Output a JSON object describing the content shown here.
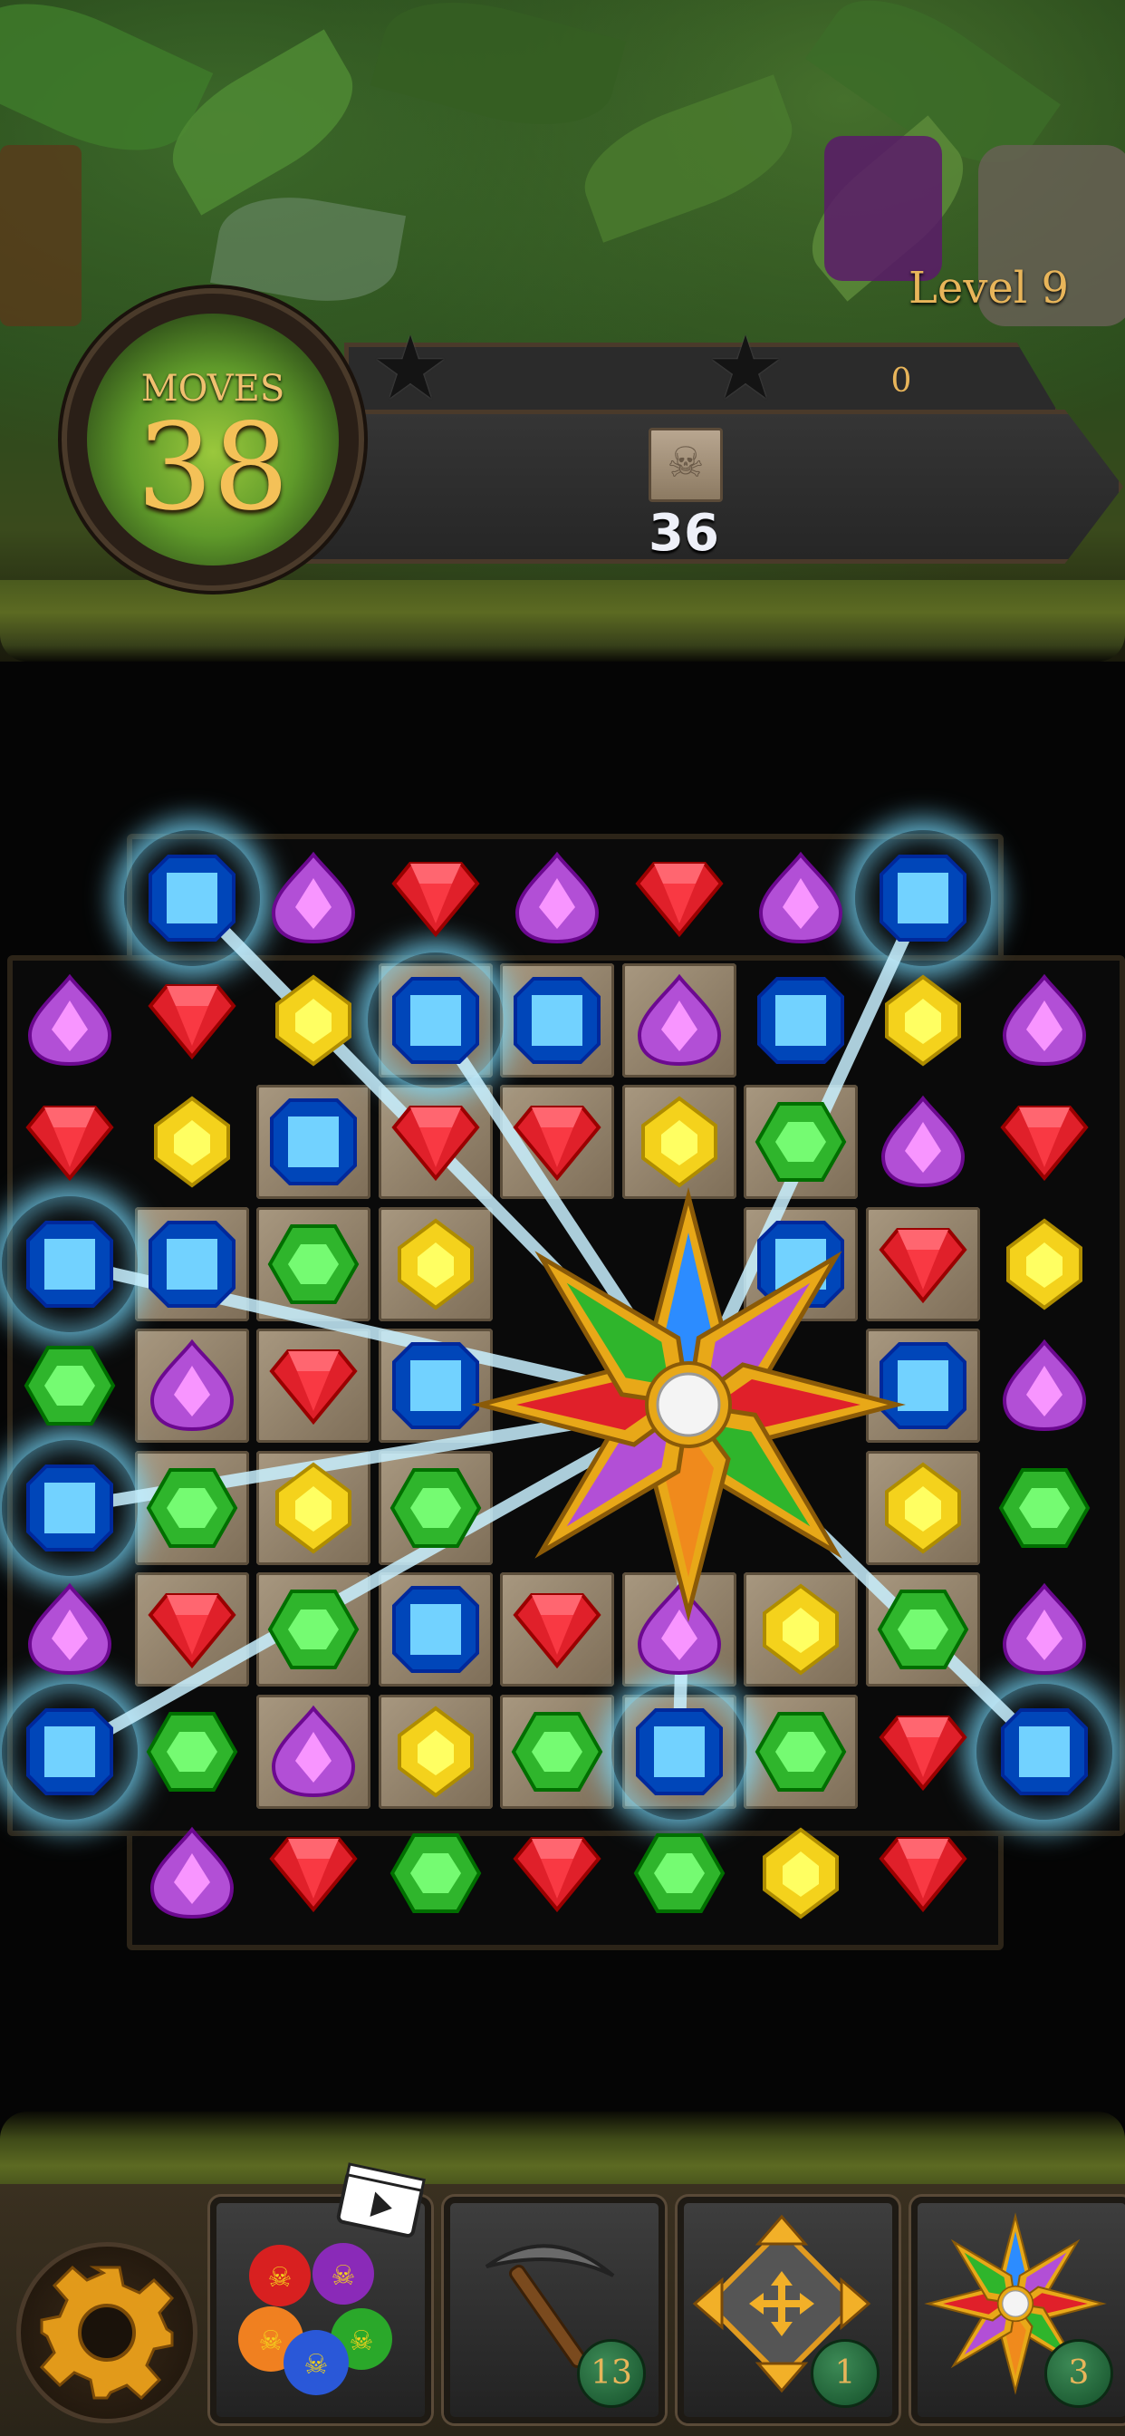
{
  "hud": {
    "level_label": "Level 9",
    "moves_title": "MOVES",
    "moves_value": "38",
    "score_value": "0",
    "target_icon": "skull-stone-tile-icon",
    "target_remaining": "36",
    "stars": [
      "star-icon",
      "star-icon"
    ]
  },
  "board": {
    "grid": [
      [
        "",
        "blue",
        "purple",
        "red",
        "purple",
        "red",
        "purple",
        "blue",
        ""
      ],
      [
        "purple",
        "red",
        "yellow",
        "blue",
        "blue",
        "purple",
        "blue",
        "yellow",
        "purple"
      ],
      [
        "red",
        "yellow",
        "blue",
        "red",
        "red",
        "yellow",
        "green",
        "purple",
        "red"
      ],
      [
        "blue",
        "blue",
        "green",
        "yellow",
        "",
        "",
        "blue",
        "red",
        "yellow"
      ],
      [
        "green",
        "purple",
        "red",
        "blue",
        "",
        "",
        "",
        "blue",
        "purple"
      ],
      [
        "blue",
        "green",
        "yellow",
        "green",
        "",
        "",
        "",
        "yellow",
        "green"
      ],
      [
        "purple",
        "red",
        "green",
        "blue",
        "red",
        "purple",
        "yellow",
        "green",
        "purple"
      ],
      [
        "blue",
        "green",
        "purple",
        "yellow",
        "green",
        "blue",
        "green",
        "red",
        "blue"
      ],
      [
        "",
        "purple",
        "red",
        "green",
        "red",
        "green",
        "yellow",
        "red",
        ""
      ]
    ],
    "stone_tiles": [
      [
        1,
        3
      ],
      [
        1,
        4
      ],
      [
        1,
        5
      ],
      [
        2,
        2
      ],
      [
        2,
        3
      ],
      [
        2,
        4
      ],
      [
        2,
        5
      ],
      [
        2,
        6
      ],
      [
        3,
        1
      ],
      [
        3,
        2
      ],
      [
        3,
        3
      ],
      [
        3,
        6
      ],
      [
        3,
        7
      ],
      [
        4,
        1
      ],
      [
        4,
        2
      ],
      [
        4,
        3
      ],
      [
        4,
        7
      ],
      [
        5,
        1
      ],
      [
        5,
        2
      ],
      [
        5,
        3
      ],
      [
        5,
        7
      ],
      [
        6,
        1
      ],
      [
        6,
        2
      ],
      [
        6,
        3
      ],
      [
        6,
        4
      ],
      [
        6,
        5
      ],
      [
        6,
        6
      ],
      [
        6,
        7
      ],
      [
        7,
        2
      ],
      [
        7,
        3
      ],
      [
        7,
        4
      ],
      [
        7,
        5
      ],
      [
        7,
        6
      ]
    ],
    "glowing": [
      [
        0,
        1
      ],
      [
        0,
        7
      ],
      [
        3,
        0
      ],
      [
        5,
        0
      ],
      [
        7,
        0
      ],
      [
        7,
        8
      ],
      [
        7,
        5
      ],
      [
        1,
        3
      ]
    ],
    "special_piece": "rainbow-star-bomb"
  },
  "gem_colors": {
    "red": "#e0202a",
    "blue": "#2c8cff",
    "purple": "#b24fd6",
    "yellow": "#f4d21c",
    "green": "#2fb52c"
  },
  "boosters": [
    {
      "name": "bombs",
      "icon": "bomb-cluster-icon",
      "count": "",
      "has_video": true
    },
    {
      "name": "pickaxe",
      "icon": "pickaxe-icon",
      "count": "13"
    },
    {
      "name": "shuffle",
      "icon": "move-arrows-icon",
      "count": "1"
    },
    {
      "name": "star-bomb",
      "icon": "rainbow-star-icon",
      "count": "3"
    }
  ]
}
